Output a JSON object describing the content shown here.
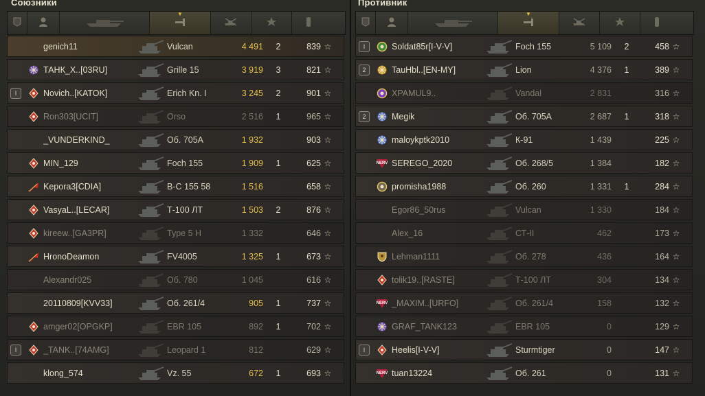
{
  "allies": {
    "title": "Союзники",
    "rows": [
      {
        "rank": "",
        "clan": "",
        "clan_color": "",
        "name": "genich11",
        "tank": "Vulcan",
        "damage": "4 491",
        "frags": "2",
        "xp": "839",
        "star": "☆",
        "self": true,
        "dead": false
      },
      {
        "rank": "",
        "clan": "crest",
        "clan_color": "#6a4ea8",
        "name": "ТАНК_Х..[03RU]",
        "tank": "Grille 15",
        "damage": "3 919",
        "frags": "3",
        "xp": "821",
        "star": "☆",
        "self": false,
        "dead": false
      },
      {
        "rank": "I",
        "clan": "diamond",
        "clan_color": "#c23a2a",
        "name": "Novich..[KATOK]",
        "tank": "Erich Kn. I",
        "damage": "3 245",
        "frags": "2",
        "xp": "901",
        "star": "☆",
        "self": false,
        "dead": false
      },
      {
        "rank": "",
        "clan": "diamond",
        "clan_color": "#c23a2a",
        "name": "Ron303[UCIT]",
        "tank": "Orso",
        "damage": "2 516",
        "frags": "1",
        "xp": "965",
        "star": "☆",
        "self": false,
        "dead": true
      },
      {
        "rank": "",
        "clan": "",
        "clan_color": "",
        "name": "_VUNDERKIND_",
        "tank": "Об. 705А",
        "damage": "1 932",
        "frags": "",
        "xp": "903",
        "star": "☆",
        "self": false,
        "dead": false
      },
      {
        "rank": "",
        "clan": "diamond",
        "clan_color": "#c23a2a",
        "name": "MIN_129",
        "tank": "Foch 155",
        "damage": "1 909",
        "frags": "1",
        "xp": "625",
        "star": "☆",
        "self": false,
        "dead": false
      },
      {
        "rank": "",
        "clan": "flag",
        "clan_color": "#d02a20",
        "name": "Kepora3[CDIA]",
        "tank": "В-С 155 58",
        "damage": "1 516",
        "frags": "",
        "xp": "658",
        "star": "☆",
        "self": false,
        "dead": false
      },
      {
        "rank": "",
        "clan": "diamond",
        "clan_color": "#c23a2a",
        "name": "VasyaL..[LECAR]",
        "tank": "Т-100 ЛТ",
        "damage": "1 503",
        "frags": "2",
        "xp": "876",
        "star": "☆",
        "self": false,
        "dead": false
      },
      {
        "rank": "",
        "clan": "diamond",
        "clan_color": "#c23a2a",
        "name": "kireew..[GA3PR]",
        "tank": "Type 5 H",
        "damage": "1 332",
        "frags": "",
        "xp": "646",
        "star": "☆",
        "self": false,
        "dead": true
      },
      {
        "rank": "",
        "clan": "flag",
        "clan_color": "#d02a20",
        "name": "HronoDeamon",
        "tank": "FV4005",
        "damage": "1 325",
        "frags": "1",
        "xp": "673",
        "star": "☆",
        "self": false,
        "dead": false
      },
      {
        "rank": "",
        "clan": "",
        "clan_color": "",
        "name": "Alexandr025",
        "tank": "Об. 780",
        "damage": "1 045",
        "frags": "",
        "xp": "616",
        "star": "☆",
        "self": false,
        "dead": true
      },
      {
        "rank": "",
        "clan": "",
        "clan_color": "",
        "name": "20110809[KVV33]",
        "tank": "Об. 261/4",
        "damage": "905",
        "frags": "1",
        "xp": "737",
        "star": "☆",
        "self": false,
        "dead": false
      },
      {
        "rank": "",
        "clan": "diamond",
        "clan_color": "#c23a2a",
        "name": "amger02[OPGKP]",
        "tank": "EBR 105",
        "damage": "892",
        "frags": "1",
        "xp": "702",
        "star": "☆",
        "self": false,
        "dead": true
      },
      {
        "rank": "I",
        "clan": "diamond",
        "clan_color": "#c23a2a",
        "name": "_TANK..[74AMG]",
        "tank": "Leopard 1",
        "damage": "812",
        "frags": "",
        "xp": "629",
        "star": "☆",
        "self": false,
        "dead": true
      },
      {
        "rank": "",
        "clan": "",
        "clan_color": "",
        "name": "klong_574",
        "tank": "Vz. 55",
        "damage": "672",
        "frags": "1",
        "xp": "693",
        "star": "☆",
        "self": false,
        "dead": false
      }
    ]
  },
  "enemies": {
    "title": "Противник",
    "rows": [
      {
        "rank": "I",
        "clan": "ring",
        "clan_color": "#3f8a3a",
        "name": "Soldat85r[I-V-V]",
        "tank": "Foch 155",
        "damage": "5 109",
        "frags": "2",
        "xp": "458",
        "star": "☆",
        "self": false,
        "dead": false
      },
      {
        "rank": "2",
        "clan": "crest",
        "clan_color": "#c99a2e",
        "name": "TauHbl..[EN-MY]",
        "tank": "Lion",
        "damage": "4 376",
        "frags": "1",
        "xp": "389",
        "star": "☆",
        "self": false,
        "dead": false
      },
      {
        "rank": "",
        "clan": "ring",
        "clan_color": "#7a3fb8",
        "name": "XPAMUL9..",
        "tank": "Vandal",
        "damage": "2 831",
        "frags": "",
        "xp": "316",
        "star": "☆",
        "self": false,
        "dead": true
      },
      {
        "rank": "2",
        "clan": "crest",
        "clan_color": "#5a78c8",
        "name": "Megik",
        "tank": "Об. 705А",
        "damage": "2 687",
        "frags": "1",
        "xp": "318",
        "star": "☆",
        "self": false,
        "dead": false
      },
      {
        "rank": "",
        "clan": "crest",
        "clan_color": "#5a78c8",
        "name": "maloykptk2010",
        "tank": "К-91",
        "damage": "1 439",
        "frags": "",
        "xp": "225",
        "star": "☆",
        "self": false,
        "dead": false
      },
      {
        "rank": "",
        "clan": "NERV",
        "clan_color": "#b0203a",
        "name": "SEREGO_2020",
        "tank": "Об. 268/5",
        "damage": "1 384",
        "frags": "",
        "xp": "182",
        "star": "☆",
        "self": false,
        "dead": false
      },
      {
        "rank": "",
        "clan": "ring",
        "clan_color": "#6f6a58",
        "name": "promisha1988",
        "tank": "Об. 260",
        "damage": "1 331",
        "frags": "1",
        "xp": "284",
        "star": "☆",
        "self": false,
        "dead": false
      },
      {
        "rank": "",
        "clan": "",
        "clan_color": "",
        "name": "Egor86_50rus",
        "tank": "Vulcan",
        "damage": "1 330",
        "frags": "",
        "xp": "184",
        "star": "☆",
        "self": false,
        "dead": true
      },
      {
        "rank": "",
        "clan": "",
        "clan_color": "",
        "name": "Alex_16",
        "tank": "СТ-II",
        "damage": "462",
        "frags": "",
        "xp": "173",
        "star": "☆",
        "self": false,
        "dead": true
      },
      {
        "rank": "",
        "clan": "shield",
        "clan_color": "#b8953a",
        "name": "Lehman1111",
        "tank": "Об. 278",
        "damage": "436",
        "frags": "",
        "xp": "164",
        "star": "☆",
        "self": false,
        "dead": true
      },
      {
        "rank": "",
        "clan": "diamond",
        "clan_color": "#c23a2a",
        "name": "tolik19..[RASTE]",
        "tank": "Т-100 ЛТ",
        "damage": "304",
        "frags": "",
        "xp": "134",
        "star": "☆",
        "self": false,
        "dead": true
      },
      {
        "rank": "",
        "clan": "NERV",
        "clan_color": "#b0203a",
        "name": "_MAXIM..[URFO]",
        "tank": "Об. 261/4",
        "damage": "158",
        "frags": "",
        "xp": "132",
        "star": "☆",
        "self": false,
        "dead": true
      },
      {
        "rank": "",
        "clan": "crest",
        "clan_color": "#6a4ea8",
        "name": "GRAF_TANK123",
        "tank": "EBR 105",
        "damage": "0",
        "frags": "",
        "xp": "129",
        "star": "☆",
        "self": false,
        "dead": true
      },
      {
        "rank": "I",
        "clan": "diamond",
        "clan_color": "#c23a2a",
        "name": "Heelis[I-V-V]",
        "tank": "Sturmtiger",
        "damage": "0",
        "frags": "",
        "xp": "147",
        "star": "☆",
        "self": false,
        "dead": false
      },
      {
        "rank": "",
        "clan": "NERV",
        "clan_color": "#b0203a",
        "name": "tuan13224",
        "tank": "Об. 261",
        "damage": "0",
        "frags": "",
        "xp": "131",
        "star": "☆",
        "self": false,
        "dead": false
      }
    ]
  },
  "header_icons": [
    "rank-icon",
    "player-icon",
    "tank-icon",
    "damage-icon",
    "frags-icon",
    "xp-star-icon",
    "medal-icon"
  ],
  "sort_column": "damage",
  "sort_marker": "▼"
}
